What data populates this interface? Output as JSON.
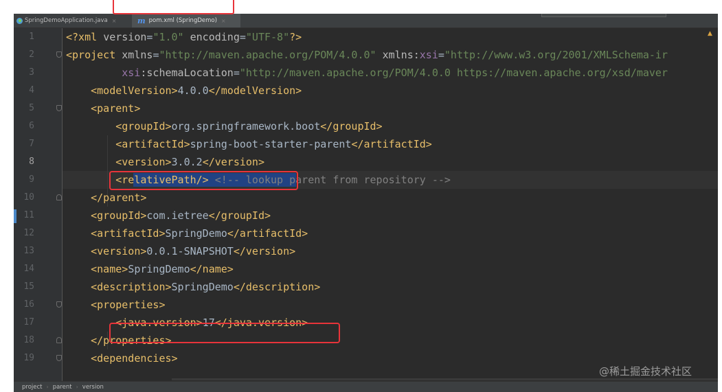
{
  "tabs": [
    {
      "label": "SpringDemoApplication.java",
      "icon": "java-class-icon",
      "close": "×"
    },
    {
      "label": "pom.xml (SpringDemo)",
      "icon": "maven-icon",
      "icon_glyph": "m",
      "close": "×",
      "active": true
    }
  ],
  "editor": {
    "warning_icon": "▲",
    "current_line": 8,
    "lines": [
      {
        "n": "1",
        "fold": "",
        "tokens": [
          {
            "c": "tag",
            "t": "<?xml "
          },
          {
            "c": "attr",
            "t": "version"
          },
          {
            "c": "text",
            "t": "="
          },
          {
            "c": "str",
            "t": "\"1.0\""
          },
          {
            "c": "text",
            "t": " "
          },
          {
            "c": "attr",
            "t": "encoding"
          },
          {
            "c": "text",
            "t": "="
          },
          {
            "c": "str",
            "t": "\"UTF-8\""
          },
          {
            "c": "tag",
            "t": "?>"
          }
        ]
      },
      {
        "n": "2",
        "fold": "open",
        "tokens": [
          {
            "c": "tag",
            "t": "<project "
          },
          {
            "c": "attr",
            "t": "xmlns"
          },
          {
            "c": "text",
            "t": "="
          },
          {
            "c": "str",
            "t": "\"http://maven.apache.org/POM/4.0.0\""
          },
          {
            "c": "text",
            "t": " "
          },
          {
            "c": "attr",
            "t": "xmlns:"
          },
          {
            "c": "ns",
            "t": "xsi"
          },
          {
            "c": "text",
            "t": "="
          },
          {
            "c": "str",
            "t": "\"http://www.w3.org/2001/XMLSchema-ir"
          }
        ]
      },
      {
        "n": "3",
        "fold": "",
        "tokens": [
          {
            "c": "text",
            "t": "         "
          },
          {
            "c": "ns",
            "t": "xsi"
          },
          {
            "c": "attr",
            "t": ":schemaLocation"
          },
          {
            "c": "text",
            "t": "="
          },
          {
            "c": "str",
            "t": "\"http://maven.apache.org/POM/4.0.0 https://maven.apache.org/xsd/maver"
          }
        ]
      },
      {
        "n": "4",
        "fold": "",
        "tokens": [
          {
            "c": "text",
            "t": "    "
          },
          {
            "c": "tag",
            "t": "<modelVersion>"
          },
          {
            "c": "text",
            "t": "4.0.0"
          },
          {
            "c": "tag",
            "t": "</modelVersion>"
          }
        ]
      },
      {
        "n": "5",
        "fold": "open",
        "tokens": [
          {
            "c": "text",
            "t": "    "
          },
          {
            "c": "tag",
            "t": "<parent>"
          }
        ]
      },
      {
        "n": "6",
        "fold": "",
        "tokens": [
          {
            "c": "text",
            "t": "        "
          },
          {
            "c": "tag",
            "t": "<groupId>"
          },
          {
            "c": "text",
            "t": "org.springframework.boot"
          },
          {
            "c": "tag",
            "t": "</groupId>"
          }
        ]
      },
      {
        "n": "7",
        "fold": "",
        "tokens": [
          {
            "c": "text",
            "t": "        "
          },
          {
            "c": "tag",
            "t": "<artifactId>"
          },
          {
            "c": "text",
            "t": "spring-boot-starter-parent"
          },
          {
            "c": "tag",
            "t": "</artifactId>"
          }
        ]
      },
      {
        "n": "8",
        "fold": "",
        "tokens": [
          {
            "c": "text",
            "t": "        "
          },
          {
            "c": "tag",
            "t": "<version>"
          },
          {
            "c": "text",
            "t": "3.0.2"
          },
          {
            "c": "tag",
            "t": "</version>"
          }
        ]
      },
      {
        "n": "9",
        "fold": "",
        "tokens": [
          {
            "c": "text",
            "t": "        "
          },
          {
            "c": "tag",
            "t": "<relativePath/>"
          },
          {
            "c": "text",
            "t": " "
          },
          {
            "c": "comment",
            "t": "<!-- lookup parent from repository -->"
          }
        ]
      },
      {
        "n": "10",
        "fold": "close",
        "tokens": [
          {
            "c": "text",
            "t": "    "
          },
          {
            "c": "tag",
            "t": "</parent>"
          }
        ]
      },
      {
        "n": "11",
        "fold": "",
        "tokens": [
          {
            "c": "text",
            "t": "    "
          },
          {
            "c": "tag",
            "t": "<groupId>"
          },
          {
            "c": "text",
            "t": "com.ietree"
          },
          {
            "c": "tag",
            "t": "</groupId>"
          }
        ]
      },
      {
        "n": "12",
        "fold": "",
        "tokens": [
          {
            "c": "text",
            "t": "    "
          },
          {
            "c": "tag",
            "t": "<artifactId>"
          },
          {
            "c": "text",
            "t": "SpringDemo"
          },
          {
            "c": "tag",
            "t": "</artifactId>"
          }
        ]
      },
      {
        "n": "13",
        "fold": "",
        "tokens": [
          {
            "c": "text",
            "t": "    "
          },
          {
            "c": "tag",
            "t": "<version>"
          },
          {
            "c": "text",
            "t": "0.0.1-SNAPSHOT"
          },
          {
            "c": "tag",
            "t": "</version>"
          }
        ]
      },
      {
        "n": "14",
        "fold": "",
        "tokens": [
          {
            "c": "text",
            "t": "    "
          },
          {
            "c": "tag",
            "t": "<name>"
          },
          {
            "c": "text",
            "t": "SpringDemo"
          },
          {
            "c": "tag",
            "t": "</name>"
          }
        ]
      },
      {
        "n": "15",
        "fold": "",
        "tokens": [
          {
            "c": "text",
            "t": "    "
          },
          {
            "c": "tag",
            "t": "<description>"
          },
          {
            "c": "text",
            "t": "SpringDemo"
          },
          {
            "c": "tag",
            "t": "</description>"
          }
        ]
      },
      {
        "n": "16",
        "fold": "open",
        "tokens": [
          {
            "c": "text",
            "t": "    "
          },
          {
            "c": "tag",
            "t": "<properties>"
          }
        ]
      },
      {
        "n": "17",
        "fold": "",
        "tokens": [
          {
            "c": "text",
            "t": "        "
          },
          {
            "c": "tag",
            "t": "<java.version>"
          },
          {
            "c": "text",
            "t": "17"
          },
          {
            "c": "tag",
            "t": "</java.version>"
          }
        ]
      },
      {
        "n": "18",
        "fold": "close",
        "tokens": [
          {
            "c": "text",
            "t": "    "
          },
          {
            "c": "tag",
            "t": "</properties>"
          }
        ]
      },
      {
        "n": "19",
        "fold": "open",
        "tokens": [
          {
            "c": "text",
            "t": "    "
          },
          {
            "c": "tag",
            "t": "<dependencies>"
          }
        ]
      }
    ]
  },
  "watermark": "@稀土掘金技术社区",
  "breadcrumb": [
    "project",
    "parent",
    "version"
  ],
  "breadcrumb_sep": "›",
  "colors": {
    "background": "#2b2b2b",
    "tag": "#e8bf6a",
    "string": "#6a8759",
    "namespace": "#9876aa",
    "comment": "#808080",
    "highlight_box": "#e8343a",
    "selection": "#214283"
  }
}
